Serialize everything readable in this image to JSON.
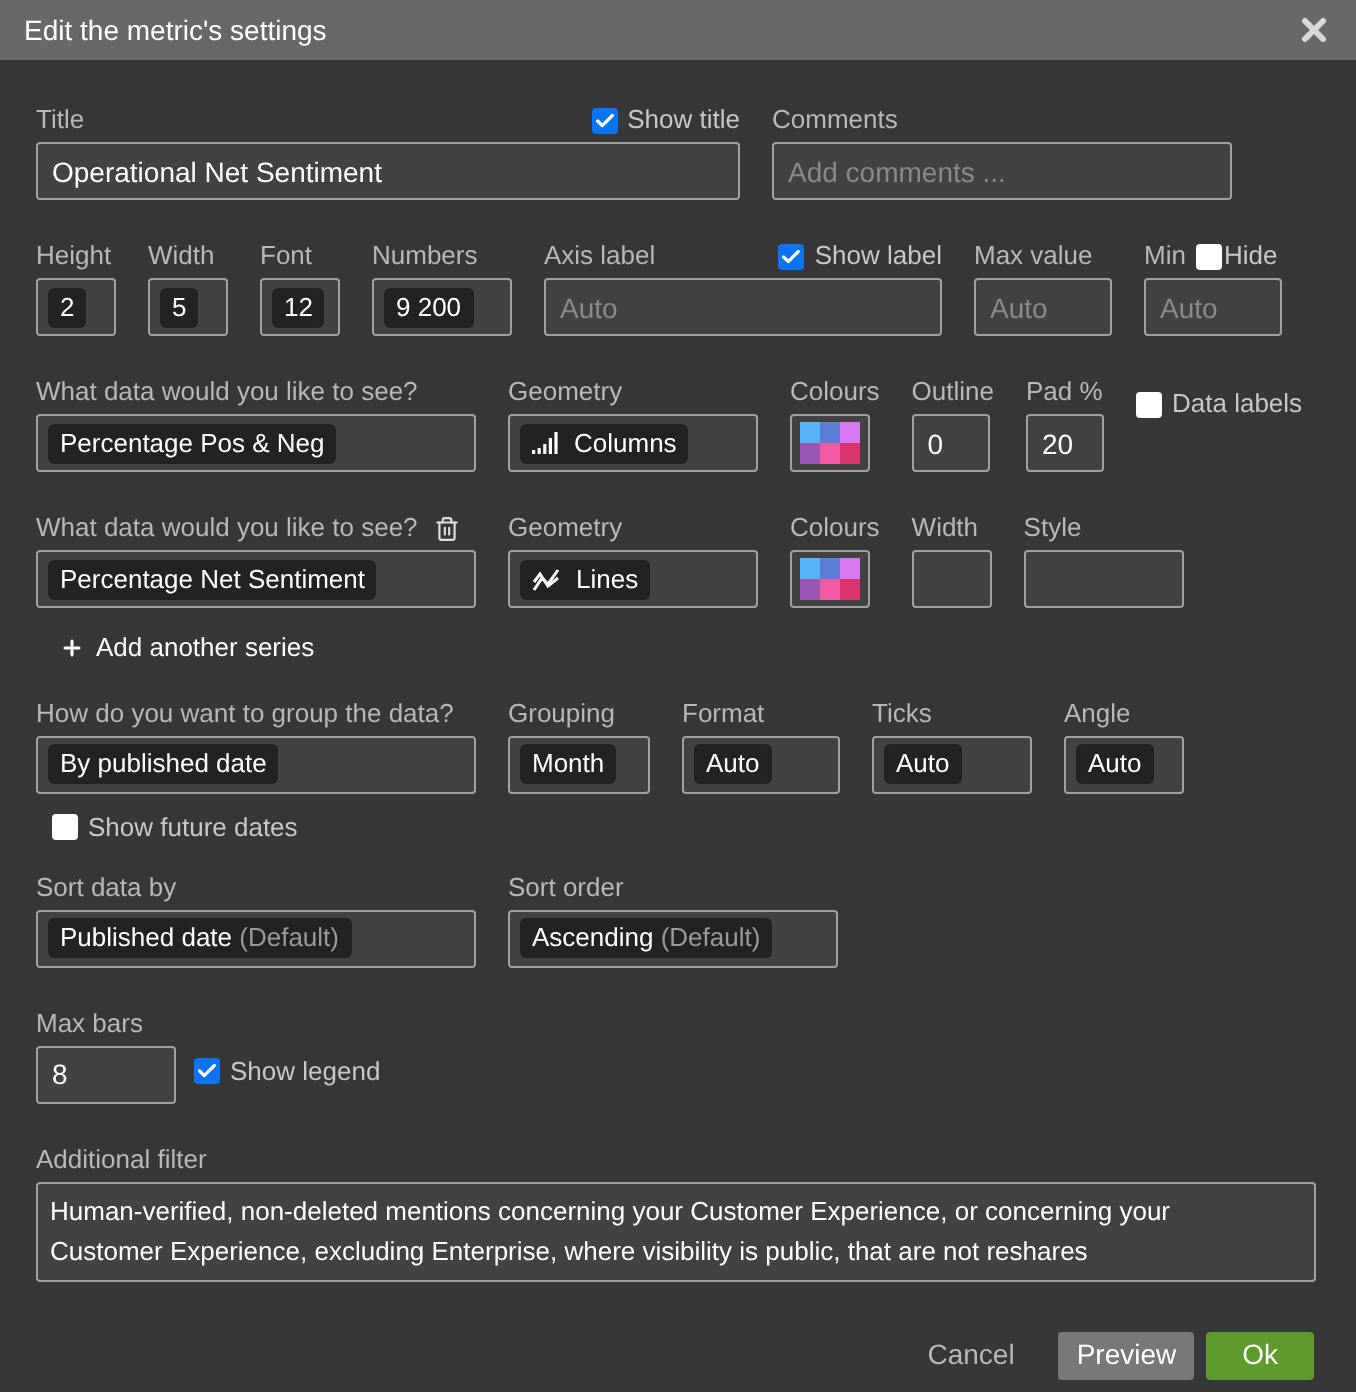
{
  "window": {
    "title": "Edit the metric's settings"
  },
  "title_field": {
    "label": "Title",
    "value": "Operational Net Sentiment",
    "show_title": {
      "label": "Show title",
      "checked": true
    }
  },
  "comments": {
    "label": "Comments",
    "placeholder": "Add comments ..."
  },
  "sizes": [
    {
      "label": "Height",
      "value": "2"
    },
    {
      "label": "Width",
      "value": "5"
    },
    {
      "label": "Font",
      "value": "12"
    },
    {
      "label": "Numbers",
      "value": "9 200"
    }
  ],
  "axis_label": {
    "label": "Axis label",
    "placeholder": "Auto",
    "show_label": {
      "label": "Show label",
      "checked": true
    }
  },
  "max_value": {
    "label": "Max value",
    "placeholder": "Auto"
  },
  "min_value": {
    "label": "Min",
    "placeholder": "Auto",
    "hide": {
      "label": "Hide",
      "checked": false
    }
  },
  "series": [
    {
      "data_label": "What data would you like to see?",
      "data": "Percentage Pos & Neg",
      "deletable": false,
      "geometry_label": "Geometry",
      "geometry": {
        "kind": "columns",
        "value": "Columns"
      },
      "colours_label": "Colours",
      "extras": [
        {
          "label": "Outline",
          "value": "0"
        },
        {
          "label": "Pad %",
          "value": "20"
        }
      ],
      "data_labels": {
        "label": "Data labels",
        "checked": false
      }
    },
    {
      "data_label": "What data would you like to see?",
      "data": "Percentage Net Sentiment",
      "deletable": true,
      "geometry_label": "Geometry",
      "geometry": {
        "kind": "lines",
        "value": "Lines"
      },
      "colours_label": "Colours",
      "extras": [
        {
          "label": "Width"
        },
        {
          "label": "Style"
        }
      ]
    }
  ],
  "add_series": "Add another series",
  "grouping": [
    {
      "label": "How do you want to group the data?",
      "value": "By published date"
    },
    {
      "label": "Grouping",
      "value": "Month"
    },
    {
      "label": "Format",
      "value": "Auto"
    },
    {
      "label": "Ticks",
      "value": "Auto"
    },
    {
      "label": "Angle",
      "value": "Auto"
    }
  ],
  "show_future_dates": {
    "label": "Show future dates",
    "checked": false
  },
  "sort": [
    {
      "label": "Sort data by",
      "value": "Published date",
      "note": "(Default)"
    },
    {
      "label": "Sort order",
      "value": "Ascending",
      "note": "(Default)"
    }
  ],
  "max_bars": {
    "label": "Max bars",
    "value": "8"
  },
  "show_legend": {
    "label": "Show legend",
    "checked": true
  },
  "filter": {
    "label": "Additional filter",
    "value": "Human-verified, non-deleted mentions concerning your Customer Experience, or concerning your Customer Experience, excluding Enterprise, where visibility is public, that are not reshares"
  },
  "buttons": [
    {
      "label": "Cancel",
      "kind": "link"
    },
    {
      "label": "Preview",
      "kind": "secondary"
    },
    {
      "label": "Ok",
      "kind": "primary"
    }
  ]
}
